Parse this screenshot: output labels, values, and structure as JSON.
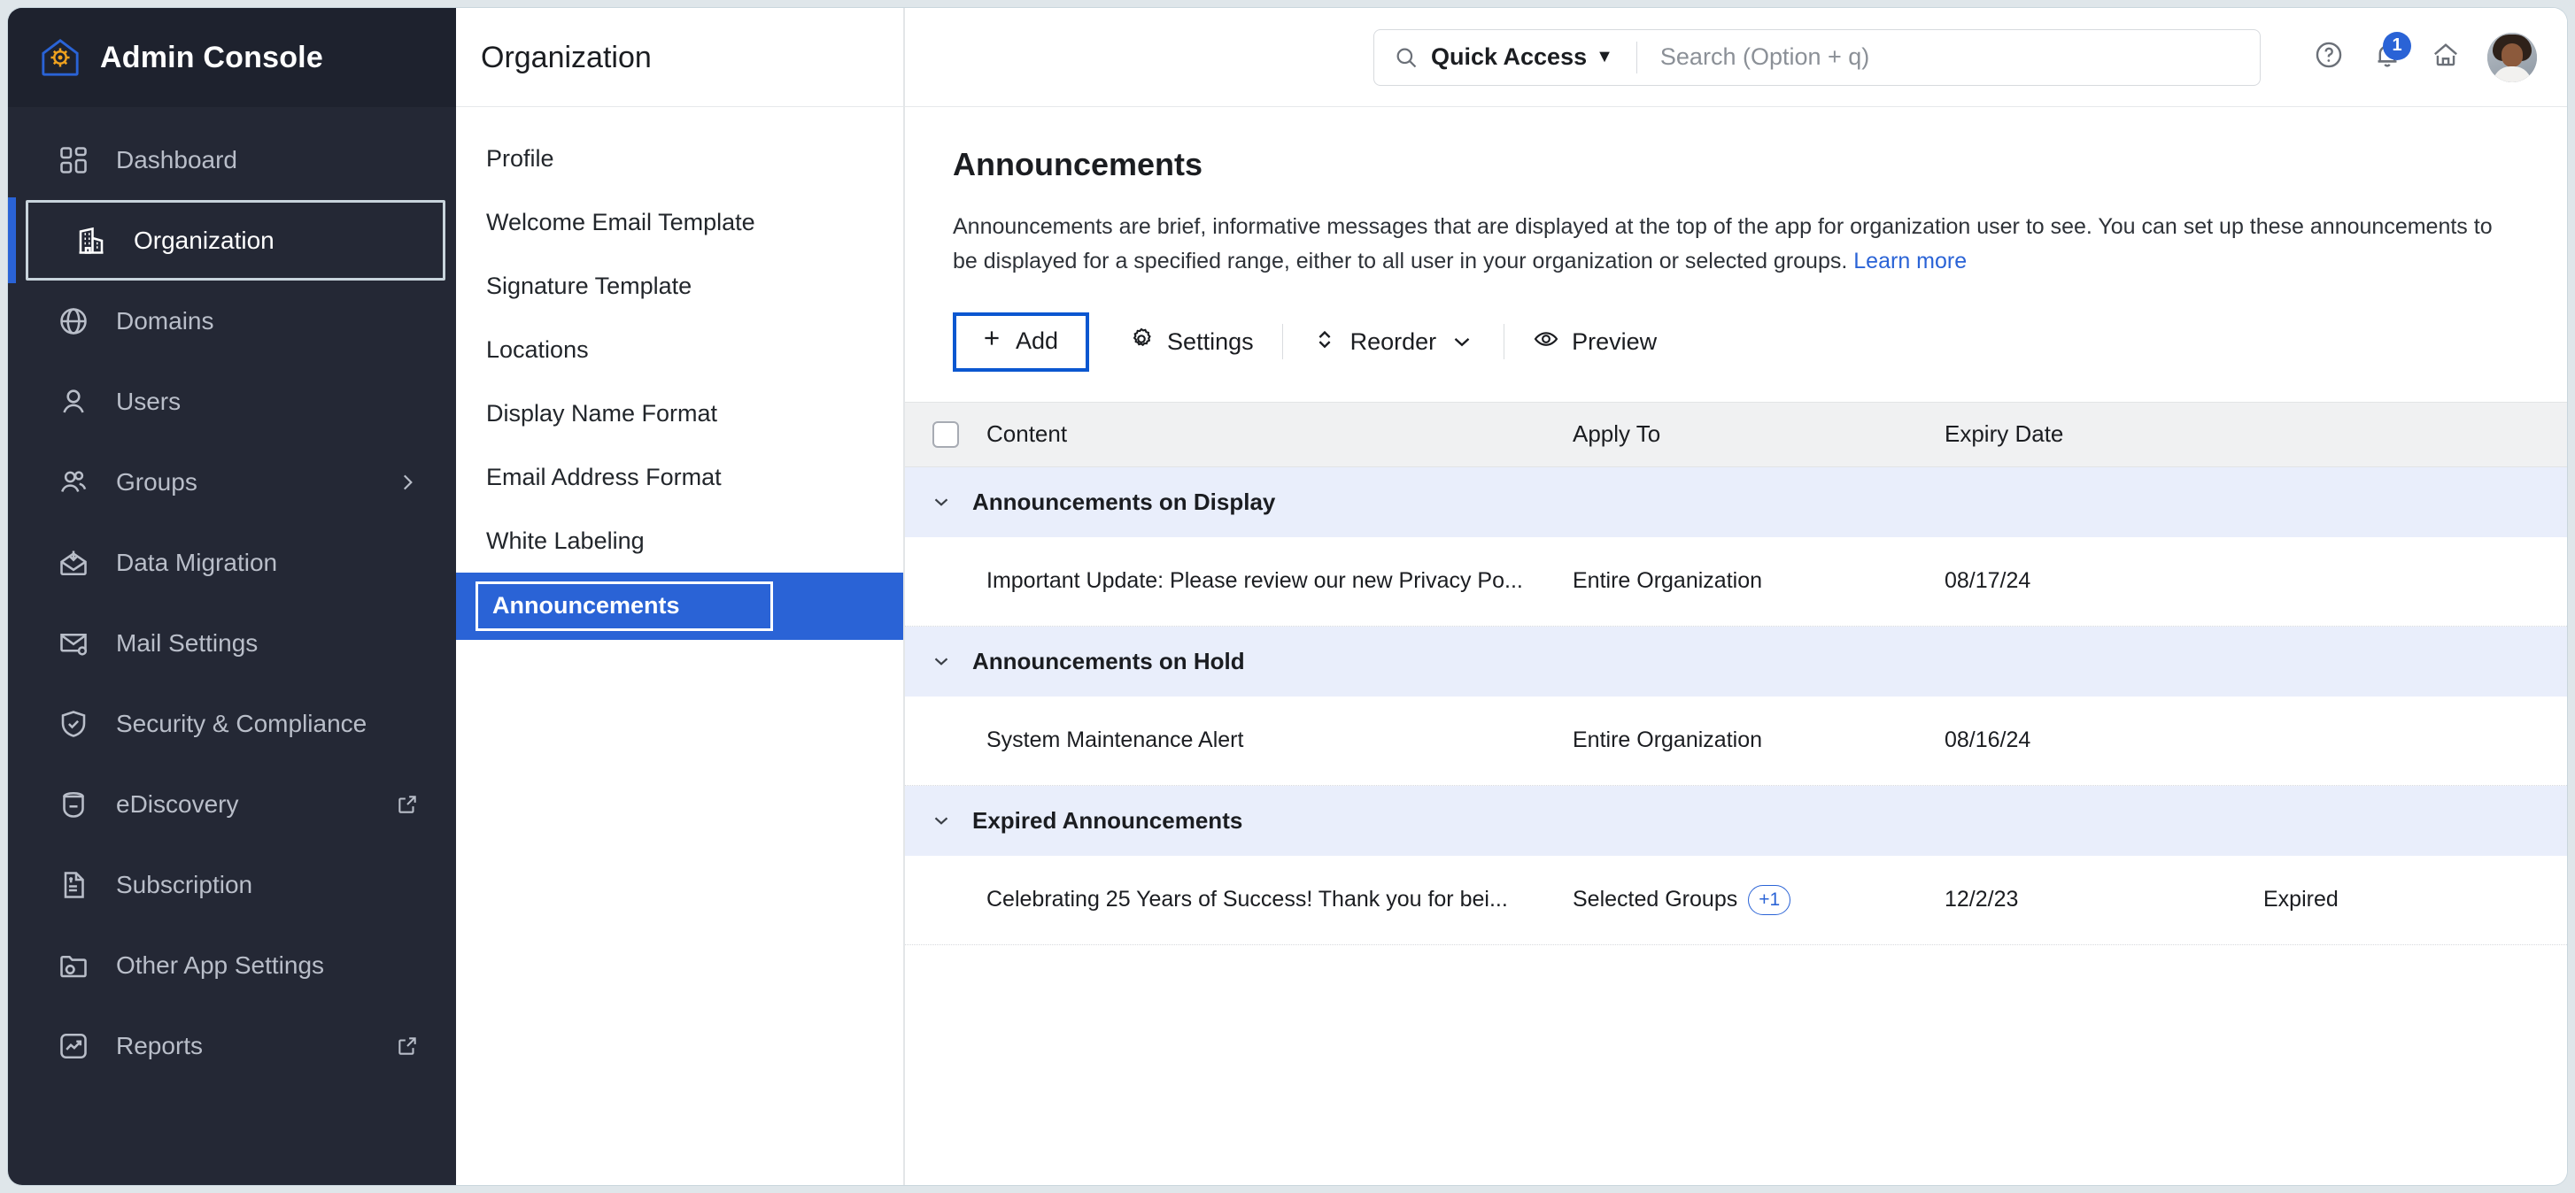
{
  "brand": {
    "title": "Admin Console",
    "logo_icon": "house-gear-icon"
  },
  "sidebar": {
    "items": [
      {
        "label": "Dashboard",
        "icon": "dashboard-grid-icon",
        "selected": false,
        "right_icon": ""
      },
      {
        "label": "Organization",
        "icon": "building-icon",
        "selected": true,
        "right_icon": ""
      },
      {
        "label": "Domains",
        "icon": "globe-icon",
        "selected": false,
        "right_icon": ""
      },
      {
        "label": "Users",
        "icon": "user-icon",
        "selected": false,
        "right_icon": ""
      },
      {
        "label": "Groups",
        "icon": "users-group-icon",
        "selected": false,
        "right_icon": "chevron-right-icon"
      },
      {
        "label": "Data Migration",
        "icon": "envelope-download-icon",
        "selected": false,
        "right_icon": ""
      },
      {
        "label": "Mail Settings",
        "icon": "envelope-gear-icon",
        "selected": false,
        "right_icon": ""
      },
      {
        "label": "Security & Compliance",
        "icon": "shield-check-icon",
        "selected": false,
        "right_icon": ""
      },
      {
        "label": "eDiscovery",
        "icon": "archive-icon",
        "selected": false,
        "right_icon": "external-link-icon"
      },
      {
        "label": "Subscription",
        "icon": "invoice-dollar-icon",
        "selected": false,
        "right_icon": ""
      },
      {
        "label": "Other App Settings",
        "icon": "folder-gear-icon",
        "selected": false,
        "right_icon": ""
      },
      {
        "label": "Reports",
        "icon": "chart-line-icon",
        "selected": false,
        "right_icon": "external-link-icon"
      }
    ]
  },
  "subnav": {
    "title": "Organization",
    "items": [
      {
        "label": "Profile",
        "active": false
      },
      {
        "label": "Welcome Email Template",
        "active": false
      },
      {
        "label": "Signature Template",
        "active": false
      },
      {
        "label": "Locations",
        "active": false
      },
      {
        "label": "Display Name Format",
        "active": false
      },
      {
        "label": "Email Address Format",
        "active": false
      },
      {
        "label": "White Labeling",
        "active": false
      },
      {
        "label": "Announcements",
        "active": true
      }
    ]
  },
  "header": {
    "quick_access_label": "Quick Access",
    "quick_access_caret": "▼",
    "search_placeholder": "Search (Option + q)",
    "search_value": "",
    "search_icon": "search-icon",
    "help_icon": "help-circle-icon",
    "notifications_icon": "bell-icon",
    "notifications_badge": "1",
    "home_icon": "home-icon",
    "avatar_icon": "user-avatar"
  },
  "main": {
    "title": "Announcements",
    "description": "Announcements are brief, informative messages that are displayed at the top of the app for organization user to see. You can set up these announcements to be displayed for a specified range, either to all user in your organization or selected groups.",
    "learn_more": "Learn more",
    "toolbar": {
      "add_label": "Add",
      "add_icon": "plus-icon",
      "settings_label": "Settings",
      "settings_icon": "gear-icon",
      "reorder_label": "Reorder",
      "reorder_icon": "sort-updown-icon",
      "reorder_caret_icon": "chevron-down-icon",
      "preview_label": "Preview",
      "preview_icon": "eye-icon"
    },
    "table": {
      "columns": {
        "select_all": "",
        "content": "Content",
        "apply_to": "Apply To",
        "expiry_date": "Expiry Date",
        "status": ""
      },
      "groups": [
        {
          "label": "Announcements on Display",
          "expanded": true,
          "rows": [
            {
              "content": "Important Update: Please review our new Privacy Po...",
              "apply_to": "Entire Organization",
              "apply_to_extra": "",
              "expiry_date": "08/17/24",
              "status_type": "toggle",
              "toggle_on": true,
              "status_text": ""
            }
          ]
        },
        {
          "label": "Announcements on Hold",
          "expanded": true,
          "rows": [
            {
              "content": "System Maintenance Alert",
              "apply_to": "Entire Organization",
              "apply_to_extra": "",
              "expiry_date": "08/16/24",
              "status_type": "toggle",
              "toggle_on": false,
              "status_text": ""
            }
          ]
        },
        {
          "label": "Expired Announcements",
          "expanded": true,
          "rows": [
            {
              "content": "Celebrating 25 Years of Success! Thank you for bei...",
              "apply_to": "Selected Groups",
              "apply_to_extra": "+1",
              "expiry_date": "12/2/23",
              "status_type": "text",
              "toggle_on": false,
              "status_text": "Expired"
            }
          ]
        }
      ]
    }
  },
  "colors": {
    "accent_blue": "#2a63d6",
    "focus_blue": "#0b57d0",
    "sidebar_bg": "#242835",
    "group_row_bg": "#e9eefb",
    "table_head_bg": "#f0f1f2"
  }
}
